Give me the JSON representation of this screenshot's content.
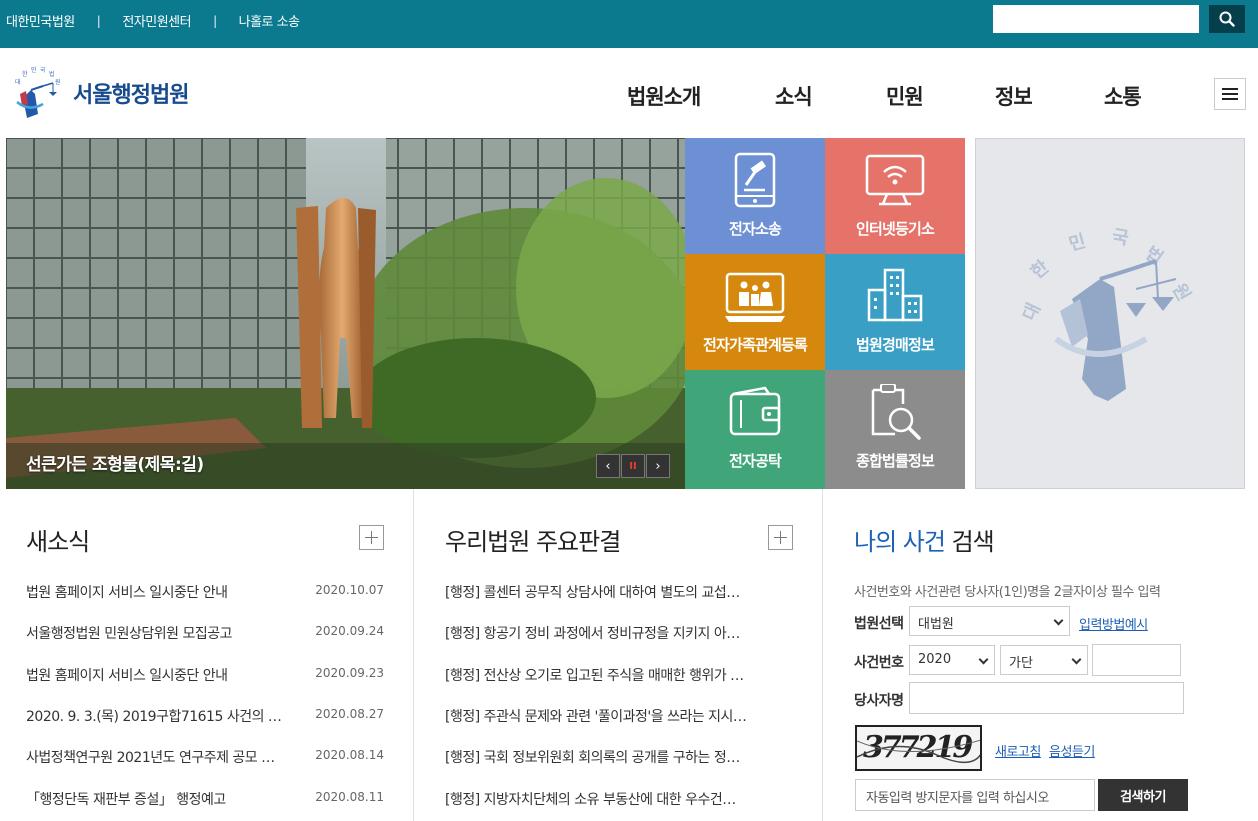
{
  "topbar": {
    "links": [
      "대한민국법원",
      "전자민원센터",
      "나홀로 소송"
    ],
    "separator": "|",
    "search_placeholder": "",
    "search_icon": "search-icon"
  },
  "header": {
    "site_name": "서울행정법원",
    "emblem_text": "대한민국법원",
    "nav": [
      "법원소개",
      "소식",
      "민원",
      "정보",
      "소통"
    ],
    "menu_icon": "hamburger-icon"
  },
  "hero": {
    "caption": "선큰가든 조형물(제목:길)",
    "prev": "‹",
    "pause": "II",
    "next": "›"
  },
  "tiles": [
    {
      "label": "전자소송",
      "color": "#6d8fd3",
      "icon": "tablet-gavel-icon"
    },
    {
      "label": "인터넷등기소",
      "color": "#e5736a",
      "icon": "monitor-wifi-icon"
    },
    {
      "label": "전자가족관계등록",
      "color": "#d6880e",
      "icon": "family-icon"
    },
    {
      "label": "법원경매정보",
      "color": "#3a9fc4",
      "icon": "buildings-icon"
    },
    {
      "label": "전자공탁",
      "color": "#41a57a",
      "icon": "wallet-icon"
    },
    {
      "label": "종합법률정보",
      "color": "#8c8c8c",
      "icon": "document-search-icon"
    }
  ],
  "emblem_panel": {
    "text": "대한민국법원"
  },
  "news": {
    "title": "새소식",
    "items": [
      {
        "title": "법원 홈페이지 서비스 일시중단 안내",
        "date": "2020.10.07"
      },
      {
        "title": "서울행정법원 민원상담위원 모집공고",
        "date": "2020.09.24"
      },
      {
        "title": "법원 홈페이지 서비스 일시중단 안내",
        "date": "2020.09.23"
      },
      {
        "title": "2020. 9. 3.(목) 2019구합71615 사건의 …",
        "date": "2020.08.27"
      },
      {
        "title": "사법정책연구원 2021년도 연구주제 공모 …",
        "date": "2020.08.14"
      },
      {
        "title": "「행정단독 재판부 증설」 행정예고",
        "date": "2020.08.11"
      }
    ]
  },
  "judgments": {
    "title": "우리법원 주요판결",
    "items": [
      "[행정] 콜센터 공무직 상담사에 대하여 별도의 교섭…",
      "[행정] 항공기 정비 과정에서 정비규정을 지키지 아…",
      "[행정] 전산상 오기로 입고된 주식을 매매한 행위가 …",
      "[행정] 주관식 문제와 관련 '풀이과정'을 쓰라는 지시…",
      "[행정] 국회 정보위원회 회의록의 공개를 구하는 정…",
      "[행정] 지방자치단체의 소유 부동산에 대한 우수건…"
    ]
  },
  "case_search": {
    "title_accent": "나의 사건",
    "title_rest": " 검색",
    "description": "사건번호와 사건관련 당사자(1인)명을 2글자이상 필수 입력",
    "court_label": "법원선택",
    "court_value": "대법원",
    "input_guide_link": "입력방법예시",
    "case_no_label": "사건번호",
    "year_value": "2020",
    "type_value": "가단",
    "party_label": "당사자명",
    "captcha_text": "377219",
    "refresh_link": "새로고침",
    "audio_link": "음성듣기",
    "captcha_placeholder": "자동입력 방지문자를 입력 하십시오",
    "submit_label": "검색하기"
  }
}
